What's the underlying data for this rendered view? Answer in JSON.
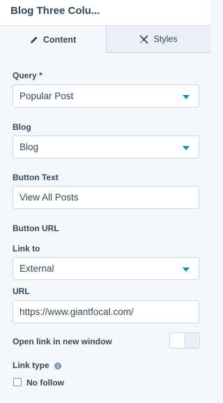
{
  "header": {
    "title": "Blog Three Colu..."
  },
  "tabs": [
    {
      "label": "Content",
      "icon": "pencil-icon",
      "active": true
    },
    {
      "label": "Styles",
      "icon": "brush-icon",
      "active": false
    }
  ],
  "fields": {
    "query": {
      "label": "Query *",
      "value": "Popular Post"
    },
    "blog": {
      "label": "Blog",
      "value": "Blog"
    },
    "button_text": {
      "label": "Button Text",
      "value": "View All Posts"
    },
    "button_url": {
      "label": "Button URL"
    },
    "link_to": {
      "label": "Link to",
      "value": "External"
    },
    "url": {
      "label": "URL",
      "value": "https://www.giantfocal.com/"
    },
    "open_new_window": {
      "label": "Open link in new window",
      "on": false
    },
    "link_type": {
      "label": "Link type",
      "info_glyph": "i"
    },
    "no_follow": {
      "label": "No follow",
      "checked": false
    }
  },
  "colors": {
    "panel_bg": "#f5f8fa",
    "text": "#33475b",
    "border": "#cbd6e2",
    "accent": "#0091ae"
  }
}
